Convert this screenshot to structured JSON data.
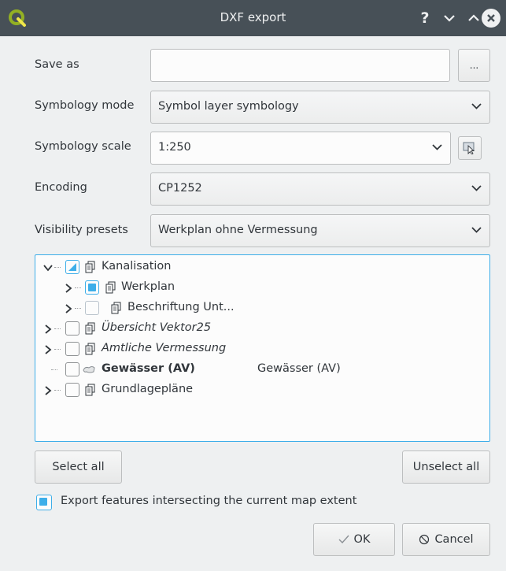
{
  "window": {
    "title": "DXF export",
    "help_label": "?",
    "app_icon": "qgis-logo-icon"
  },
  "form": {
    "save_as_label": "Save as",
    "save_as_value": "",
    "browse_label": "...",
    "symbology_mode_label": "Symbology mode",
    "symbology_mode_value": "Symbol layer symbology",
    "symbology_scale_label": "Symbology scale",
    "symbology_scale_value": "1:250",
    "encoding_label": "Encoding",
    "encoding_value": "CP1252",
    "visibility_presets_label": "Visibility presets",
    "visibility_presets_value": "Werkplan ohne Vermessung"
  },
  "tree": {
    "items": [
      {
        "label": "Kanalisation",
        "state": "partial",
        "expanded": true,
        "style": "normal"
      },
      {
        "label": "Werkplan",
        "state": "checked",
        "expanded": false,
        "style": "normal"
      },
      {
        "label": "Beschriftung Unt...",
        "state": "unchecked",
        "expanded": false,
        "style": "normal"
      },
      {
        "label": "Übersicht Vektor25",
        "state": "unchecked",
        "expanded": false,
        "style": "italic"
      },
      {
        "label": "Amtliche Vermessung",
        "state": "unchecked",
        "expanded": false,
        "style": "italic"
      },
      {
        "label": "Gewässer (AV)",
        "attribute": "Gewässer (AV)",
        "state": "unchecked",
        "style": "bold"
      },
      {
        "label": "Grundlagepläne",
        "state": "unchecked",
        "expanded": false,
        "style": "normal"
      }
    ]
  },
  "actions": {
    "select_all": "Select all",
    "unselect_all": "Unselect all",
    "export_extent_label": "Export features intersecting the current map extent",
    "export_extent_checked": true,
    "ok": "OK",
    "cancel": "Cancel"
  },
  "colors": {
    "titlebar": "#475057",
    "accent": "#3daee9",
    "background": "#eef0f1"
  }
}
